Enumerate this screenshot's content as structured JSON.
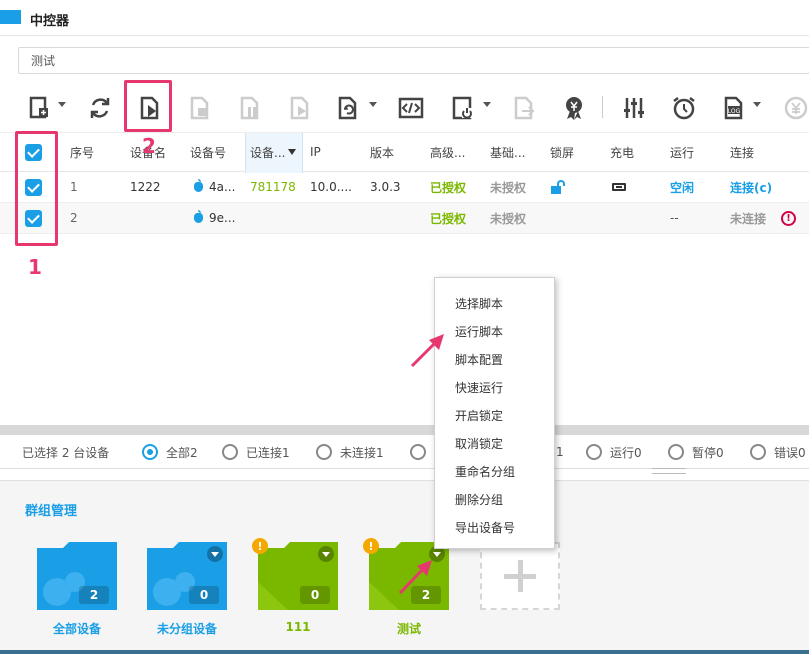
{
  "app": {
    "title": "中控器"
  },
  "search": {
    "value": "测试"
  },
  "toolbar": {
    "icons": [
      "new-device-icon",
      "refresh-icon",
      "run-script-icon",
      "stop-script-icon",
      "pause-script-icon",
      "resume-script-icon",
      "script-settings-icon",
      "script-editor-icon",
      "power-icon",
      "export-icon",
      "badge-icon",
      "adjust-icon",
      "alarm-icon",
      "log-icon",
      "yen-icon"
    ]
  },
  "annotations": {
    "label_1": "1",
    "label_2": "2"
  },
  "table": {
    "headers": {
      "seq": "序号",
      "name": "设备名",
      "device_id": "设备号",
      "device_sort": "设备...",
      "ip": "IP",
      "version": "版本",
      "advanced": "高级...",
      "basic": "基础...",
      "lock": "锁屏",
      "charge": "充电",
      "run": "运行",
      "connect": "连接"
    },
    "rows": [
      {
        "seq": "1",
        "name": "1222",
        "device_id": "4a...",
        "device_code": "781178",
        "ip": "10.0....",
        "version": "3.0.3",
        "advanced": "已授权",
        "basic": "未授权",
        "run": "空闲",
        "connect": "连接(c)"
      },
      {
        "seq": "2",
        "name": "",
        "device_id": "9e...",
        "device_code": "",
        "ip": "",
        "version": "",
        "advanced": "已授权",
        "basic": "未授权",
        "run": "--",
        "connect": "未连接",
        "warn": "!"
      }
    ]
  },
  "filter": {
    "selected": "已选择 2 台设备",
    "options": [
      "全部2",
      "已连接1",
      "未连接1",
      "1",
      "运行0",
      "暂停0",
      "错误0"
    ]
  },
  "groups": {
    "title": "群组管理",
    "items": [
      {
        "label": "全部设备",
        "count": "2",
        "color": "#1a9fe6"
      },
      {
        "label": "未分组设备",
        "count": "0",
        "color": "#1a9fe6"
      },
      {
        "label": "111",
        "count": "0",
        "color": "#7ab800",
        "warn": "!"
      },
      {
        "label": "测试",
        "count": "2",
        "color": "#7ab800",
        "warn": "!"
      }
    ]
  },
  "context_menu": {
    "items": [
      "选择脚本",
      "运行脚本",
      "脚本配置",
      "快速运行",
      "开启锁定",
      "取消锁定",
      "重命名分组",
      "删除分组",
      "导出设备号"
    ]
  },
  "colors": {
    "accent": "#1a9fe6",
    "authorized": "#7ab800",
    "highlight": "#e6386f"
  }
}
